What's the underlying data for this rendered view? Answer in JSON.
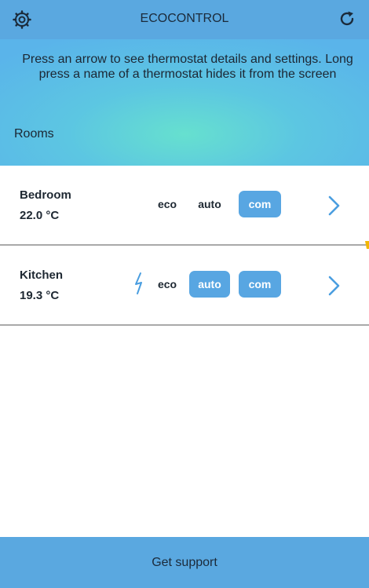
{
  "app": {
    "title": "ECOCONTROL",
    "icons": {
      "settings": "gear-icon",
      "refresh": "refresh-icon"
    },
    "accent_color": "#5aa8e0"
  },
  "info": {
    "message": "Press an arrow to see thermostat details and settings. Long press a name of a thermostat hides it from the screen",
    "section_label": "Rooms"
  },
  "rooms": [
    {
      "name": "Bedroom",
      "temperature": "22.0 °C",
      "boost": false,
      "modes": {
        "eco": {
          "label": "eco",
          "active": false
        },
        "auto": {
          "label": "auto",
          "active": false
        },
        "com": {
          "label": "com",
          "active": true
        }
      },
      "details_icon": "chevron-right-icon"
    },
    {
      "name": "Kitchen",
      "temperature": "19.3 °C",
      "boost": true,
      "boost_icon": "lightning-bolt-icon",
      "modes": {
        "eco": {
          "label": "eco",
          "active": false
        },
        "auto": {
          "label": "auto",
          "active": true
        },
        "com": {
          "label": "com",
          "active": true
        }
      },
      "details_icon": "chevron-right-icon"
    }
  ],
  "footer": {
    "support_label": "Get support"
  }
}
